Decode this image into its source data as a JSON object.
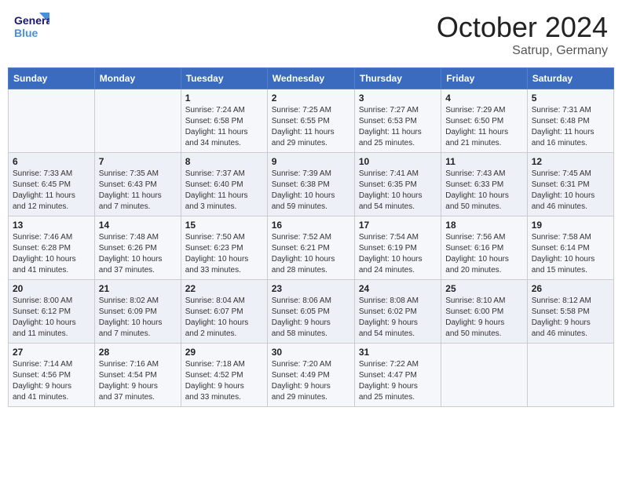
{
  "header": {
    "logo_general": "General",
    "logo_blue": "Blue",
    "title": "October 2024",
    "location": "Satrup, Germany"
  },
  "weekdays": [
    "Sunday",
    "Monday",
    "Tuesday",
    "Wednesday",
    "Thursday",
    "Friday",
    "Saturday"
  ],
  "weeks": [
    [
      {
        "day": "",
        "detail": ""
      },
      {
        "day": "",
        "detail": ""
      },
      {
        "day": "1",
        "detail": "Sunrise: 7:24 AM\nSunset: 6:58 PM\nDaylight: 11 hours\nand 34 minutes."
      },
      {
        "day": "2",
        "detail": "Sunrise: 7:25 AM\nSunset: 6:55 PM\nDaylight: 11 hours\nand 29 minutes."
      },
      {
        "day": "3",
        "detail": "Sunrise: 7:27 AM\nSunset: 6:53 PM\nDaylight: 11 hours\nand 25 minutes."
      },
      {
        "day": "4",
        "detail": "Sunrise: 7:29 AM\nSunset: 6:50 PM\nDaylight: 11 hours\nand 21 minutes."
      },
      {
        "day": "5",
        "detail": "Sunrise: 7:31 AM\nSunset: 6:48 PM\nDaylight: 11 hours\nand 16 minutes."
      }
    ],
    [
      {
        "day": "6",
        "detail": "Sunrise: 7:33 AM\nSunset: 6:45 PM\nDaylight: 11 hours\nand 12 minutes."
      },
      {
        "day": "7",
        "detail": "Sunrise: 7:35 AM\nSunset: 6:43 PM\nDaylight: 11 hours\nand 7 minutes."
      },
      {
        "day": "8",
        "detail": "Sunrise: 7:37 AM\nSunset: 6:40 PM\nDaylight: 11 hours\nand 3 minutes."
      },
      {
        "day": "9",
        "detail": "Sunrise: 7:39 AM\nSunset: 6:38 PM\nDaylight: 10 hours\nand 59 minutes."
      },
      {
        "day": "10",
        "detail": "Sunrise: 7:41 AM\nSunset: 6:35 PM\nDaylight: 10 hours\nand 54 minutes."
      },
      {
        "day": "11",
        "detail": "Sunrise: 7:43 AM\nSunset: 6:33 PM\nDaylight: 10 hours\nand 50 minutes."
      },
      {
        "day": "12",
        "detail": "Sunrise: 7:45 AM\nSunset: 6:31 PM\nDaylight: 10 hours\nand 46 minutes."
      }
    ],
    [
      {
        "day": "13",
        "detail": "Sunrise: 7:46 AM\nSunset: 6:28 PM\nDaylight: 10 hours\nand 41 minutes."
      },
      {
        "day": "14",
        "detail": "Sunrise: 7:48 AM\nSunset: 6:26 PM\nDaylight: 10 hours\nand 37 minutes."
      },
      {
        "day": "15",
        "detail": "Sunrise: 7:50 AM\nSunset: 6:23 PM\nDaylight: 10 hours\nand 33 minutes."
      },
      {
        "day": "16",
        "detail": "Sunrise: 7:52 AM\nSunset: 6:21 PM\nDaylight: 10 hours\nand 28 minutes."
      },
      {
        "day": "17",
        "detail": "Sunrise: 7:54 AM\nSunset: 6:19 PM\nDaylight: 10 hours\nand 24 minutes."
      },
      {
        "day": "18",
        "detail": "Sunrise: 7:56 AM\nSunset: 6:16 PM\nDaylight: 10 hours\nand 20 minutes."
      },
      {
        "day": "19",
        "detail": "Sunrise: 7:58 AM\nSunset: 6:14 PM\nDaylight: 10 hours\nand 15 minutes."
      }
    ],
    [
      {
        "day": "20",
        "detail": "Sunrise: 8:00 AM\nSunset: 6:12 PM\nDaylight: 10 hours\nand 11 minutes."
      },
      {
        "day": "21",
        "detail": "Sunrise: 8:02 AM\nSunset: 6:09 PM\nDaylight: 10 hours\nand 7 minutes."
      },
      {
        "day": "22",
        "detail": "Sunrise: 8:04 AM\nSunset: 6:07 PM\nDaylight: 10 hours\nand 2 minutes."
      },
      {
        "day": "23",
        "detail": "Sunrise: 8:06 AM\nSunset: 6:05 PM\nDaylight: 9 hours\nand 58 minutes."
      },
      {
        "day": "24",
        "detail": "Sunrise: 8:08 AM\nSunset: 6:02 PM\nDaylight: 9 hours\nand 54 minutes."
      },
      {
        "day": "25",
        "detail": "Sunrise: 8:10 AM\nSunset: 6:00 PM\nDaylight: 9 hours\nand 50 minutes."
      },
      {
        "day": "26",
        "detail": "Sunrise: 8:12 AM\nSunset: 5:58 PM\nDaylight: 9 hours\nand 46 minutes."
      }
    ],
    [
      {
        "day": "27",
        "detail": "Sunrise: 7:14 AM\nSunset: 4:56 PM\nDaylight: 9 hours\nand 41 minutes."
      },
      {
        "day": "28",
        "detail": "Sunrise: 7:16 AM\nSunset: 4:54 PM\nDaylight: 9 hours\nand 37 minutes."
      },
      {
        "day": "29",
        "detail": "Sunrise: 7:18 AM\nSunset: 4:52 PM\nDaylight: 9 hours\nand 33 minutes."
      },
      {
        "day": "30",
        "detail": "Sunrise: 7:20 AM\nSunset: 4:49 PM\nDaylight: 9 hours\nand 29 minutes."
      },
      {
        "day": "31",
        "detail": "Sunrise: 7:22 AM\nSunset: 4:47 PM\nDaylight: 9 hours\nand 25 minutes."
      },
      {
        "day": "",
        "detail": ""
      },
      {
        "day": "",
        "detail": ""
      }
    ]
  ]
}
